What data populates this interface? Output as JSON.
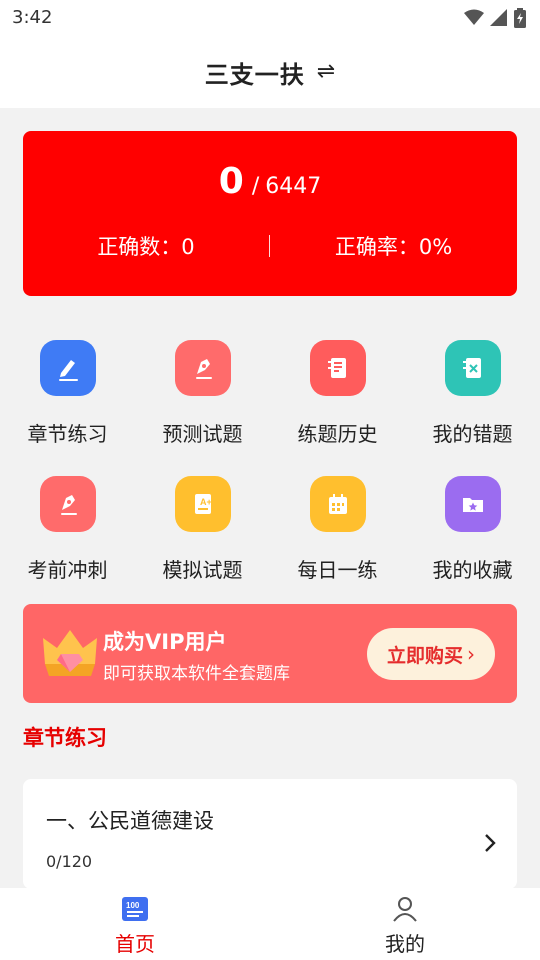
{
  "status_bar": {
    "time": "3:42",
    "icons": [
      "wifi-icon",
      "signal-icon",
      "battery-icon"
    ]
  },
  "header": {
    "title": "三支一扶",
    "switch_icon": "⇌"
  },
  "score": {
    "done": "0",
    "separator": "/",
    "total": "6447",
    "correct_count": "正确数：0",
    "correct_rate": "正确率：0%"
  },
  "features": [
    {
      "label": "章节练习",
      "icon": "pen-edit-icon",
      "color": "#3f7bf5"
    },
    {
      "label": "预测试题",
      "icon": "pen-nib-icon",
      "color": "#ff6b6b"
    },
    {
      "label": "练题历史",
      "icon": "notebook-icon",
      "color": "#ff5c5c"
    },
    {
      "label": "我的错题",
      "icon": "wrong-book-icon",
      "color": "#2ec4b6"
    },
    {
      "label": "考前冲刺",
      "icon": "pen-nib-icon",
      "color": "#ff6b6b"
    },
    {
      "label": "模拟试题",
      "icon": "exam-paper-icon",
      "color": "#ffbf2e"
    },
    {
      "label": "每日一练",
      "icon": "calendar-icon",
      "color": "#ffbf2e"
    },
    {
      "label": "我的收藏",
      "icon": "star-folder-icon",
      "color": "#9b6cf0"
    }
  ],
  "vip": {
    "title": "成为VIP用户",
    "subtitle": "即可获取本软件全套题库",
    "button_label": "立即购买",
    "button_arrow": "›"
  },
  "section": {
    "title": "章节练习"
  },
  "chapters": [
    {
      "name": "一、公民道德建设",
      "progress": "0/120"
    }
  ],
  "tabs": [
    {
      "label": "首页",
      "active": true,
      "color": "#e60000"
    },
    {
      "label": "我的",
      "active": false,
      "color": "#222222"
    }
  ],
  "colors": {
    "accent": "#ff0000",
    "section_title": "#e60000",
    "vip_banner": "#ff6666"
  }
}
